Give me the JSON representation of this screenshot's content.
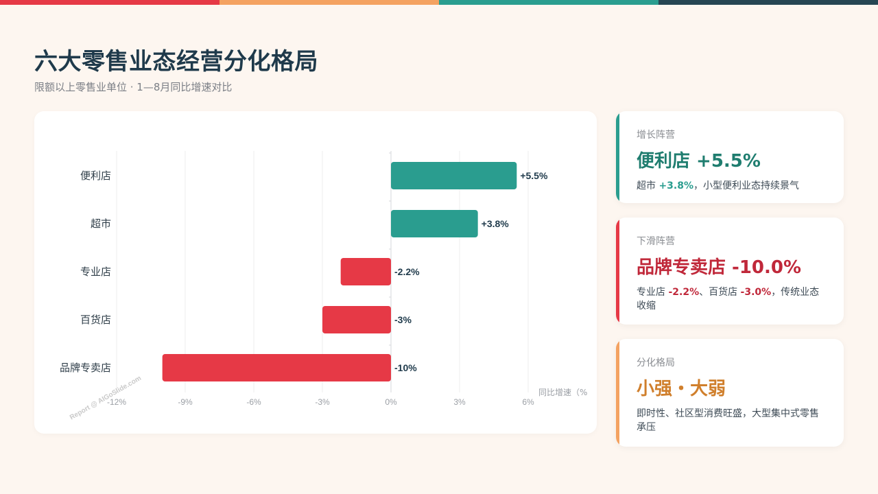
{
  "header": {
    "title": "六大零售业态经营分化格局",
    "subtitle": "限额以上零售业单位 · 1—8月同比增速对比"
  },
  "colors": {
    "strip": [
      "#e63946",
      "#f4a261",
      "#2a9d8f",
      "#264653"
    ],
    "positive": "#2a9d8f",
    "negative": "#e63946",
    "accent_orange": "#f4a261"
  },
  "chart_data": {
    "type": "bar",
    "orientation": "horizontal",
    "categories": [
      "便利店",
      "超市",
      "专业店",
      "百货店",
      "品牌专卖店"
    ],
    "values": [
      5.5,
      3.8,
      -2.2,
      -3.0,
      -10.0
    ],
    "data_labels": [
      "+5.5%",
      "+3.8%",
      "-2.2%",
      "-3%",
      "-10%"
    ],
    "xlim": [
      -12,
      8
    ],
    "xticks": [
      -12,
      -9,
      -6,
      -3,
      0,
      3,
      6
    ],
    "xtick_labels": [
      "-12%",
      "-9%",
      "-6%",
      "-3%",
      "0%",
      "3%",
      "6%"
    ],
    "xlabel": "同比增速（%",
    "grid": true
  },
  "watermark": "Report @ AIGoSlide.com",
  "cards": {
    "growth": {
      "label": "增长阵营",
      "headline": "便利店 +5.5%",
      "desc_prefix": "超市 ",
      "desc_value": "+3.8%",
      "desc_suffix": "，小型便利业态持续景气"
    },
    "decline": {
      "label": "下滑阵营",
      "headline": "品牌专卖店 -10.0%",
      "desc_prefix": "专业店 ",
      "desc_value1": "-2.2%",
      "desc_mid": "、百货店 ",
      "desc_value2": "-3.0%",
      "desc_suffix": "，传统业态收缩"
    },
    "pattern": {
      "label": "分化格局",
      "headline": "小强・大弱",
      "desc": "即时性、社区型消费旺盛，大型集中式零售承压"
    }
  }
}
